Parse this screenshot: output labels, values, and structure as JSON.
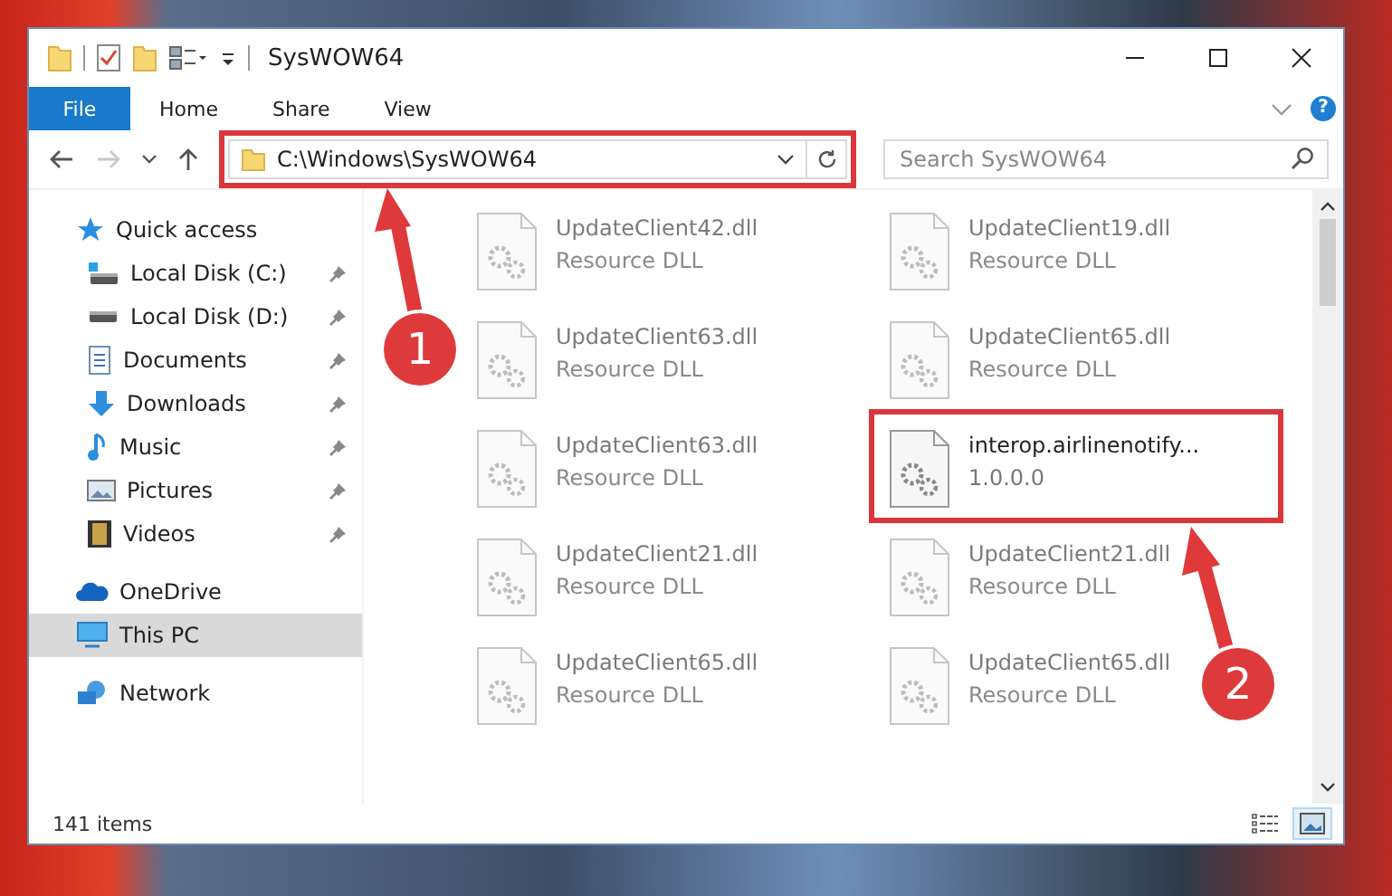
{
  "window": {
    "title": "SysWOW64",
    "ribbon_tabs": [
      {
        "label": "File",
        "selected": true
      },
      {
        "label": "Home",
        "selected": false
      },
      {
        "label": "Share",
        "selected": false
      },
      {
        "label": "View",
        "selected": false
      }
    ],
    "help": "?"
  },
  "nav_buttons": [
    {
      "kind": "back",
      "disabled": false
    },
    {
      "kind": "forward",
      "disabled": true
    },
    {
      "kind": "recent",
      "disabled": false
    },
    {
      "kind": "up",
      "disabled": false
    }
  ],
  "address_bar": {
    "path": "C:\\Windows\\SysWOW64"
  },
  "search": {
    "placeholder": "Search SysWOW64"
  },
  "sidebar": {
    "items": [
      {
        "label": "Quick access",
        "kind": "star",
        "selected": false,
        "children": [
          {
            "label": "Local Disk (C:)",
            "kind": "drive-windows",
            "pinned": true,
            "selected": false
          },
          {
            "label": "Local Disk (D:)",
            "kind": "drive",
            "pinned": true,
            "selected": false
          },
          {
            "label": "Documents",
            "kind": "documents",
            "pinned": true,
            "selected": false
          },
          {
            "label": "Downloads",
            "kind": "downloads",
            "pinned": true,
            "selected": false
          },
          {
            "label": "Music",
            "kind": "music",
            "pinned": true,
            "selected": false
          },
          {
            "label": "Pictures",
            "kind": "pictures",
            "pinned": true,
            "selected": false
          },
          {
            "label": "Videos",
            "kind": "videos",
            "pinned": true,
            "selected": false
          }
        ]
      },
      {
        "label": "OneDrive",
        "kind": "cloud",
        "selected": false
      },
      {
        "label": "This PC",
        "kind": "computer",
        "selected": true
      },
      {
        "label": "Network",
        "kind": "network",
        "selected": false
      }
    ]
  },
  "files": [
    {
      "name": "UpdateClient42.dll",
      "type": "Resource DLL",
      "dimmed": true
    },
    {
      "name": "UpdateClient19.dll",
      "type": "Resource DLL",
      "dimmed": true
    },
    {
      "name": "UpdateClient63.dll",
      "type": "Resource DLL",
      "dimmed": true
    },
    {
      "name": "UpdateClient65.dll",
      "type": "Resource DLL",
      "dimmed": true
    },
    {
      "name": "UpdateClient63.dll",
      "type": "Resource DLL",
      "dimmed": true
    },
    {
      "name": "interop.airlinenotify...",
      "type": "1.0.0.0",
      "dimmed": false
    },
    {
      "name": "UpdateClient21.dll",
      "type": "Resource DLL",
      "dimmed": true
    },
    {
      "name": "UpdateClient21.dll",
      "type": "Resource DLL",
      "dimmed": true
    },
    {
      "name": "UpdateClient65.dll",
      "type": "Resource DLL",
      "dimmed": true
    },
    {
      "name": "UpdateClient65.dll",
      "type": "Resource DLL",
      "dimmed": true
    }
  ],
  "status_bar": {
    "item_count": "141 items",
    "views": [
      {
        "kind": "details",
        "selected": false
      },
      {
        "kind": "large-icons",
        "selected": true
      }
    ]
  },
  "annotations": [
    {
      "number": "1"
    },
    {
      "number": "2"
    }
  ]
}
